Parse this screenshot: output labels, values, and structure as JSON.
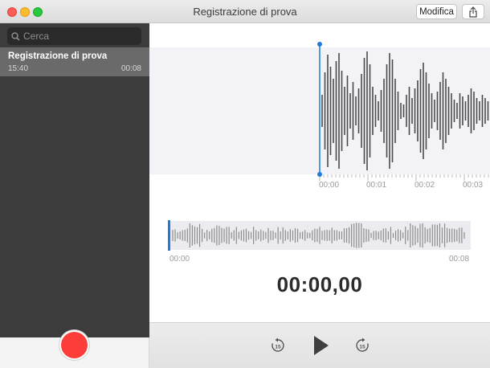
{
  "window": {
    "title": "Registrazione di prova",
    "edit_label": "Modifica"
  },
  "icons": {
    "close": "close-dot",
    "minimize": "minimize-dot",
    "maximize": "maximize-dot",
    "share": "share-icon",
    "search": "search-icon",
    "skip_back": "skip-back-15-icon",
    "play": "play-icon",
    "skip_forward": "skip-forward-15-icon"
  },
  "colors": {
    "accent": "#1f7bd6",
    "record": "#fc3d39",
    "sidebar": "#3c3c3c",
    "selected_row": "#6a6a6a"
  },
  "sidebar": {
    "search_placeholder": "Cerca",
    "recordings": [
      {
        "name": "Registrazione di prova",
        "time": "15:40",
        "duration": "00:08"
      }
    ]
  },
  "waveform": {
    "ticks": [
      "00:00",
      "00:01",
      "00:02",
      "00:03"
    ],
    "skip_seconds": "15"
  },
  "overview": {
    "start": "00:00",
    "end": "00:08"
  },
  "player": {
    "timer": "00:00,00"
  }
}
